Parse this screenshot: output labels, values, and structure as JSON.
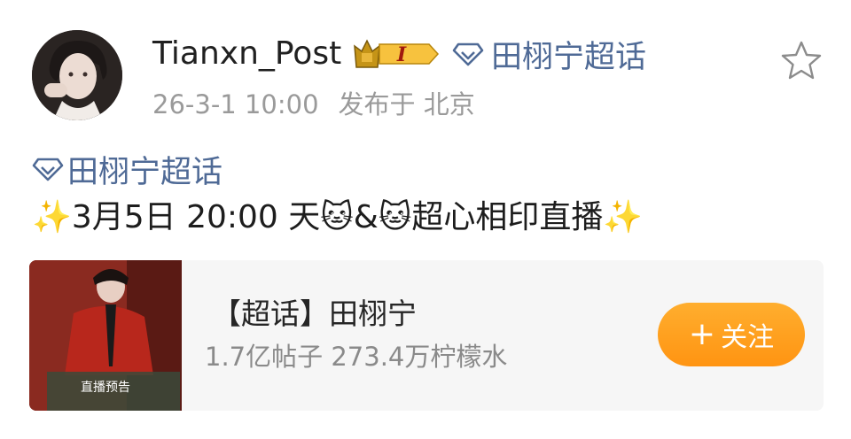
{
  "post": {
    "username": "Tianxn_Post",
    "badge_level": "I",
    "topic_link": "田栩宁超话",
    "timestamp": "26-3-1 10:00",
    "location": "发布于 北京",
    "body_topic": "田栩宁超话",
    "body_text": "✨3月5日 20:00 天🐱&🐱超心相印直播✨"
  },
  "card": {
    "title": "【超话】田栩宁",
    "stats": "1.7亿帖子 273.4万柠檬水",
    "follow_label": "关注",
    "follow_plus": "+",
    "thumb_lines": [
      "直播预告"
    ]
  },
  "icons": {
    "topic": "diamond-topic-icon",
    "favorite": "star-icon",
    "badge": "crown-badge-icon"
  },
  "colors": {
    "topic_blue": "#4f6a96",
    "follow_orange": "#ff9f1c",
    "meta_gray": "#9a9a9a",
    "card_bg": "#f6f6f6"
  }
}
